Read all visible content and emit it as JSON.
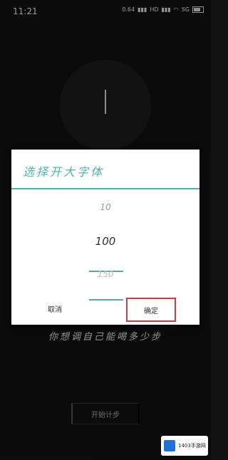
{
  "statusbar": {
    "time": "11:21",
    "network_speed": "0.64",
    "signal": "HD",
    "signal2": "5G",
    "battery_level": 0.7
  },
  "dialog": {
    "title": "选择开大字体",
    "picker": {
      "prev": "10",
      "selected": "100",
      "next": "150"
    },
    "cancel_label": "取消",
    "ok_label": "确定"
  },
  "page": {
    "hint": "你想调自己能喝多少步",
    "start_label": "开始计步"
  },
  "watermark": {
    "text": "1403手游网"
  }
}
